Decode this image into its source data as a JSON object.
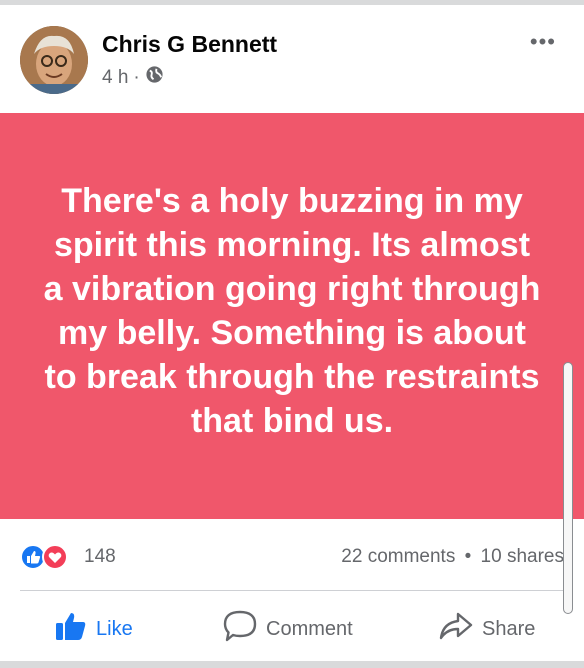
{
  "post": {
    "author": "Chris G Bennett",
    "time": "4 h",
    "separator": "·",
    "text": "There's a holy buzzing in my spirit this morning. Its almost a vibration going right through my belly. Something is about to break through the restraints that bind us.",
    "background_color": "#f0576b"
  },
  "header_icons": {
    "privacy": "globe-icon",
    "more": "more-options-icon",
    "more_glyph": "•••"
  },
  "reactions": {
    "icons": [
      "like-reaction-icon",
      "love-reaction-icon"
    ],
    "count": "148",
    "comments": "22 comments",
    "dot": "•",
    "shares": "10 shares"
  },
  "actions": {
    "like": "Like",
    "comment": "Comment",
    "share": "Share"
  },
  "colors": {
    "accent": "#1877f2",
    "love": "#f33e58",
    "text_secondary": "#65676b"
  }
}
